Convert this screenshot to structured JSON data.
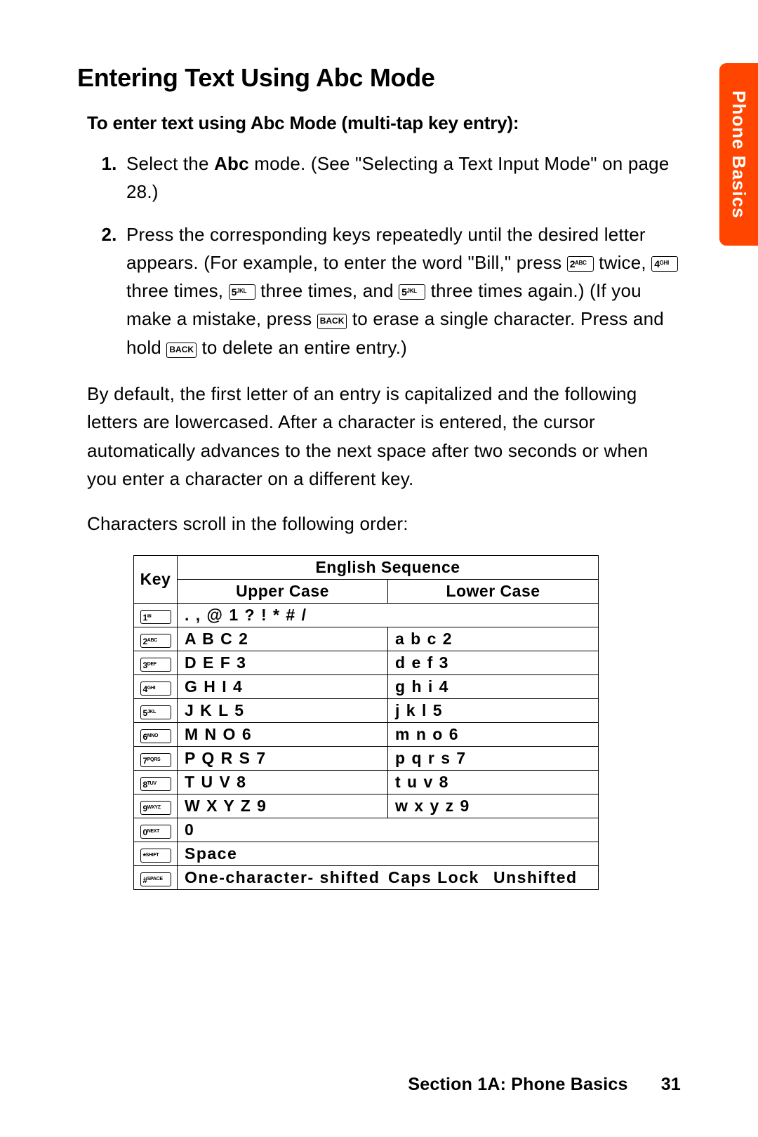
{
  "sideTab": "Phone Basics",
  "title": "Entering Text Using Abc Mode",
  "subheading": "To enter text using Abc Mode (multi-tap key entry):",
  "step1_a": "Select the ",
  "step1_bold": "Abc",
  "step1_b": " mode. (See \"Selecting a Text Input Mode\" on page 28.)",
  "step2_a": "Press the corresponding keys repeatedly until the desired letter appears. (For example, to enter the word \"Bill,\" press ",
  "step2_b": " twice, ",
  "step2_c": " three times, ",
  "step2_d": " three times, and ",
  "step2_e": " three times again.) (If you make a mistake, press ",
  "step2_f": " to erase a single character. Press and hold ",
  "step2_g": " to delete an entire entry.)",
  "key2": {
    "num": "2",
    "sup": "ABC"
  },
  "key4": {
    "num": "4",
    "sup": "GHI"
  },
  "key5": {
    "num": "5",
    "sup": "JKL"
  },
  "keyBack": "BACK",
  "para1": "By default, the first letter of an entry is capitalized and the following letters are lowercased. After a character is entered, the cursor automatically advances to the next space after two seconds or when you enter a character on a different key.",
  "para2": "Characters scroll in the following order:",
  "table": {
    "hKey": "Key",
    "hEng": "English Sequence",
    "hUpper": "Upper Case",
    "hLower": "Lower Case",
    "rows": [
      {
        "k": {
          "num": "1",
          "sup": "✉"
        },
        "full": ". , @ 1 ? ! * # /"
      },
      {
        "k": {
          "num": "2",
          "sup": "ABC"
        },
        "u": "A B C 2",
        "l": "a b c 2"
      },
      {
        "k": {
          "num": "3",
          "sup": "DEF"
        },
        "u": "D E F 3",
        "l": "d e f 3"
      },
      {
        "k": {
          "num": "4",
          "sup": "GHI"
        },
        "u": "G H I 4",
        "l": "g h i 4"
      },
      {
        "k": {
          "num": "5",
          "sup": "JKL"
        },
        "u": "J K L 5",
        "l": "j k l 5"
      },
      {
        "k": {
          "num": "6",
          "sup": "MNO"
        },
        "u": "M N O 6",
        "l": "m n o 6"
      },
      {
        "k": {
          "num": "7",
          "sup": "PQRS"
        },
        "u": "P Q R S 7",
        "l": "p q r s 7"
      },
      {
        "k": {
          "num": "8",
          "sup": "TUV"
        },
        "u": "T U V 8",
        "l": "t u v 8"
      },
      {
        "k": {
          "num": "9",
          "sup": "WXYZ"
        },
        "u": "W X Y Z 9",
        "l": "w x y z 9"
      },
      {
        "k": {
          "num": "0",
          "sup": "NEXT"
        },
        "full": "0"
      },
      {
        "k": {
          "num": "*",
          "sup": "SHIFT"
        },
        "full": "Space"
      },
      {
        "k": {
          "num": "#",
          "sup": "SPACE"
        },
        "tri": [
          "One-character- shifted",
          "Caps Lock",
          "Unshifted"
        ]
      }
    ]
  },
  "footerSection": "Section 1A: Phone Basics",
  "footerPage": "31",
  "chart_data": {
    "type": "table",
    "title": "Abc Mode character sequence by key",
    "columns": [
      "Key",
      "Upper Case",
      "Lower Case"
    ],
    "rows": [
      [
        "1",
        ". , @ 1 ? ! * # /",
        ". , @ 1 ? ! * # /"
      ],
      [
        "2",
        "A B C 2",
        "a b c 2"
      ],
      [
        "3",
        "D E F 3",
        "d e f 3"
      ],
      [
        "4",
        "G H I 4",
        "g h i 4"
      ],
      [
        "5",
        "J K L 5",
        "j k l 5"
      ],
      [
        "6",
        "M N O 6",
        "m n o 6"
      ],
      [
        "7",
        "P Q R S 7",
        "p q r s 7"
      ],
      [
        "8",
        "T U V 8",
        "t u v 8"
      ],
      [
        "9",
        "W X Y Z 9",
        "w x y z 9"
      ],
      [
        "0",
        "0",
        "0"
      ],
      [
        "*",
        "Space",
        "Space"
      ],
      [
        "#",
        "One-character-shifted / Caps Lock / Unshifted",
        "One-character-shifted / Caps Lock / Unshifted"
      ]
    ]
  }
}
